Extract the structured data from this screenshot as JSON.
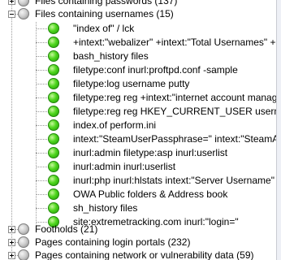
{
  "tree": {
    "top_category": {
      "label": "Files containing passwords (137)"
    },
    "expanded_category": {
      "label": "Files containing usernames (15)"
    },
    "items": [
      "\"index of\" / lck",
      "+intext:\"webalizer\" +intext:\"Total Usernames\" +inte",
      "bash_history files",
      "filetype:conf inurl:proftpd.conf -sample",
      "filetype:log username putty",
      "filetype:reg reg +intext:\"internet account manager\"",
      "filetype:reg reg HKEY_CURRENT_USER usernam",
      "index.of perform.ini",
      "intext:\"SteamUserPassphrase=\" intext:\"SteamAppl",
      "inurl:admin filetype:asp inurl:userlist",
      "inurl:admin inurl:userlist",
      "inurl:php inurl:hlstats intext:\"Server Username\"",
      "OWA Public folders & Address book",
      "sh_history files",
      "site:extremetracking.com inurl:\"login=\""
    ],
    "categories_below": [
      "Footholds (21)",
      "Pages containing login portals (232)",
      "Pages containing network or vulnerability data (59)"
    ]
  },
  "colors": {
    "item_dot": "#3cc814",
    "category_dot": "#b4b4b4",
    "tree_lines": "#9a9a9a"
  }
}
